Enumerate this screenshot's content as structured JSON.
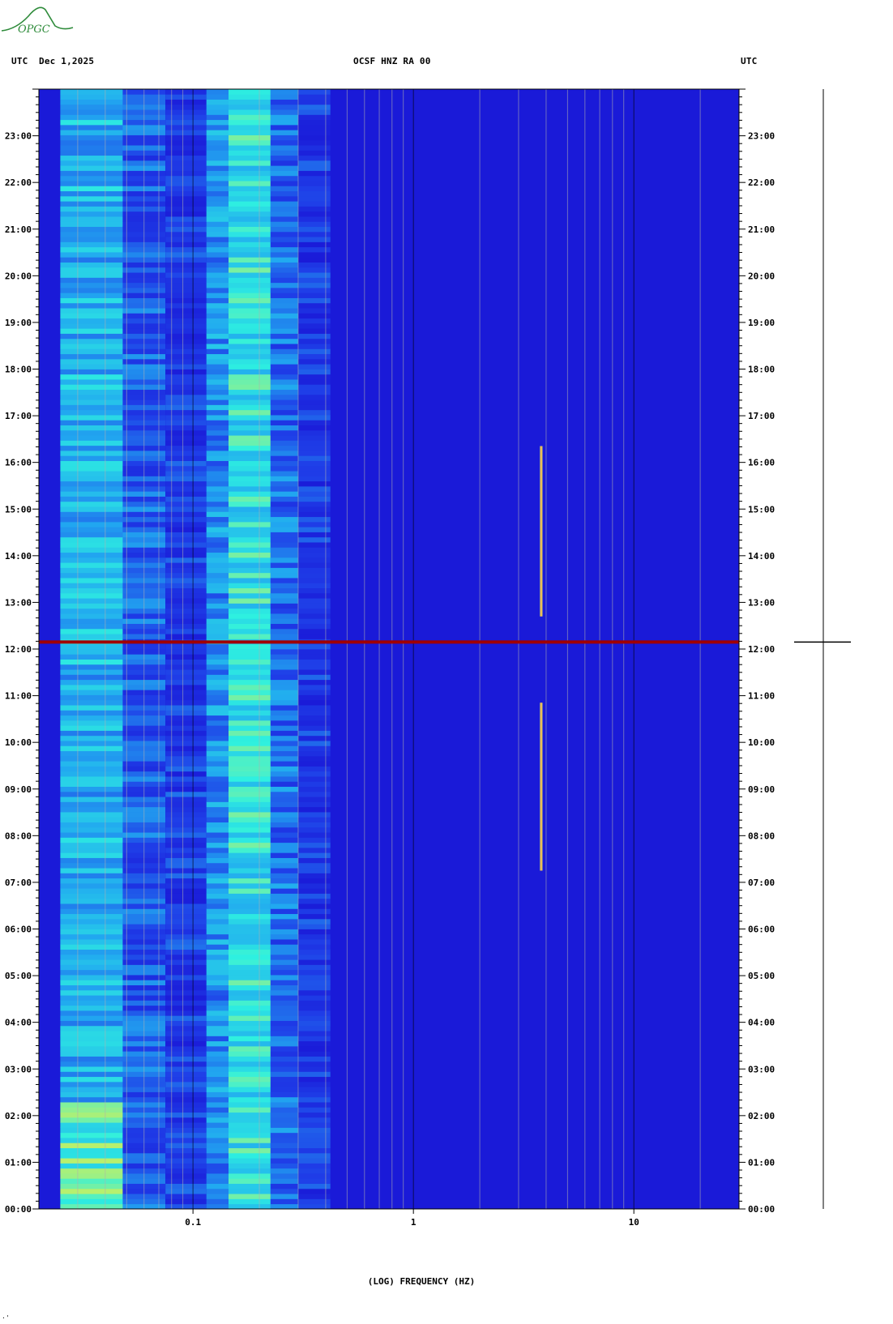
{
  "header": {
    "left_tz": "UTC",
    "date": "Dec 1,2025",
    "station": "OCSF HNZ RA 00",
    "right_tz": "UTC"
  },
  "logo": {
    "text": "OPGC",
    "color": "#2e8b3a"
  },
  "corner_mark": "·'",
  "chart_data": {
    "type": "heatmap",
    "title": "OCSF HNZ RA 00",
    "xlabel": "(LOG) FREQUENCY (HZ)",
    "ylabel": "",
    "x_scale": "log",
    "xlim": [
      0.02,
      30
    ],
    "x_ticks": [
      {
        "value": 0.1,
        "label": "0.1"
      },
      {
        "value": 1,
        "label": "1"
      },
      {
        "value": 10,
        "label": "10"
      }
    ],
    "ylim_hours": [
      0,
      24
    ],
    "y_ticks_left": [
      "00:00",
      "01:00",
      "02:00",
      "03:00",
      "04:00",
      "05:00",
      "06:00",
      "07:00",
      "08:00",
      "09:00",
      "10:00",
      "11:00",
      "12:00",
      "13:00",
      "14:00",
      "15:00",
      "16:00",
      "17:00",
      "18:00",
      "19:00",
      "20:00",
      "21:00",
      "22:00",
      "23:00"
    ],
    "y_ticks_right": [
      "00:00",
      "01:00",
      "02:00",
      "03:00",
      "04:00",
      "05:00",
      "06:00",
      "07:00",
      "08:00",
      "09:00",
      "10:00",
      "11:00",
      "12:00",
      "13:00",
      "14:00",
      "15:00",
      "16:00",
      "17:00",
      "18:00",
      "19:00",
      "20:00",
      "21:00",
      "22:00",
      "23:00"
    ],
    "energy_bands": [
      {
        "f_low": 0.025,
        "f_high": 0.048,
        "level": 0.55
      },
      {
        "f_low": 0.048,
        "f_high": 0.075,
        "level": 0.3
      },
      {
        "f_low": 0.075,
        "f_high": 0.115,
        "level": 0.2
      },
      {
        "f_low": 0.115,
        "f_high": 0.145,
        "level": 0.45
      },
      {
        "f_low": 0.145,
        "f_high": 0.225,
        "level": 0.7
      },
      {
        "f_low": 0.225,
        "f_high": 0.3,
        "level": 0.35
      },
      {
        "f_low": 0.3,
        "f_high": 0.42,
        "level": 0.18
      }
    ],
    "events": [
      {
        "type": "broadband_line",
        "time_hours": 12.15,
        "color": "#a00000"
      },
      {
        "type": "narrowband_track",
        "freq_hz": 3.8,
        "start_hours": 12.7,
        "end_hours": 16.35
      },
      {
        "type": "narrowband_track",
        "freq_hz": 3.8,
        "start_hours": 7.25,
        "end_hours": 10.85
      }
    ],
    "colors": {
      "background": "#1a1ad8",
      "low": "#1f3fe8",
      "mid": "#21a8f0",
      "high": "#2ef0e0",
      "peak": "#c8f060",
      "gridline": "#b0b0b0"
    },
    "seismogram_trace": {
      "event_time_hours": 12.15
    }
  }
}
